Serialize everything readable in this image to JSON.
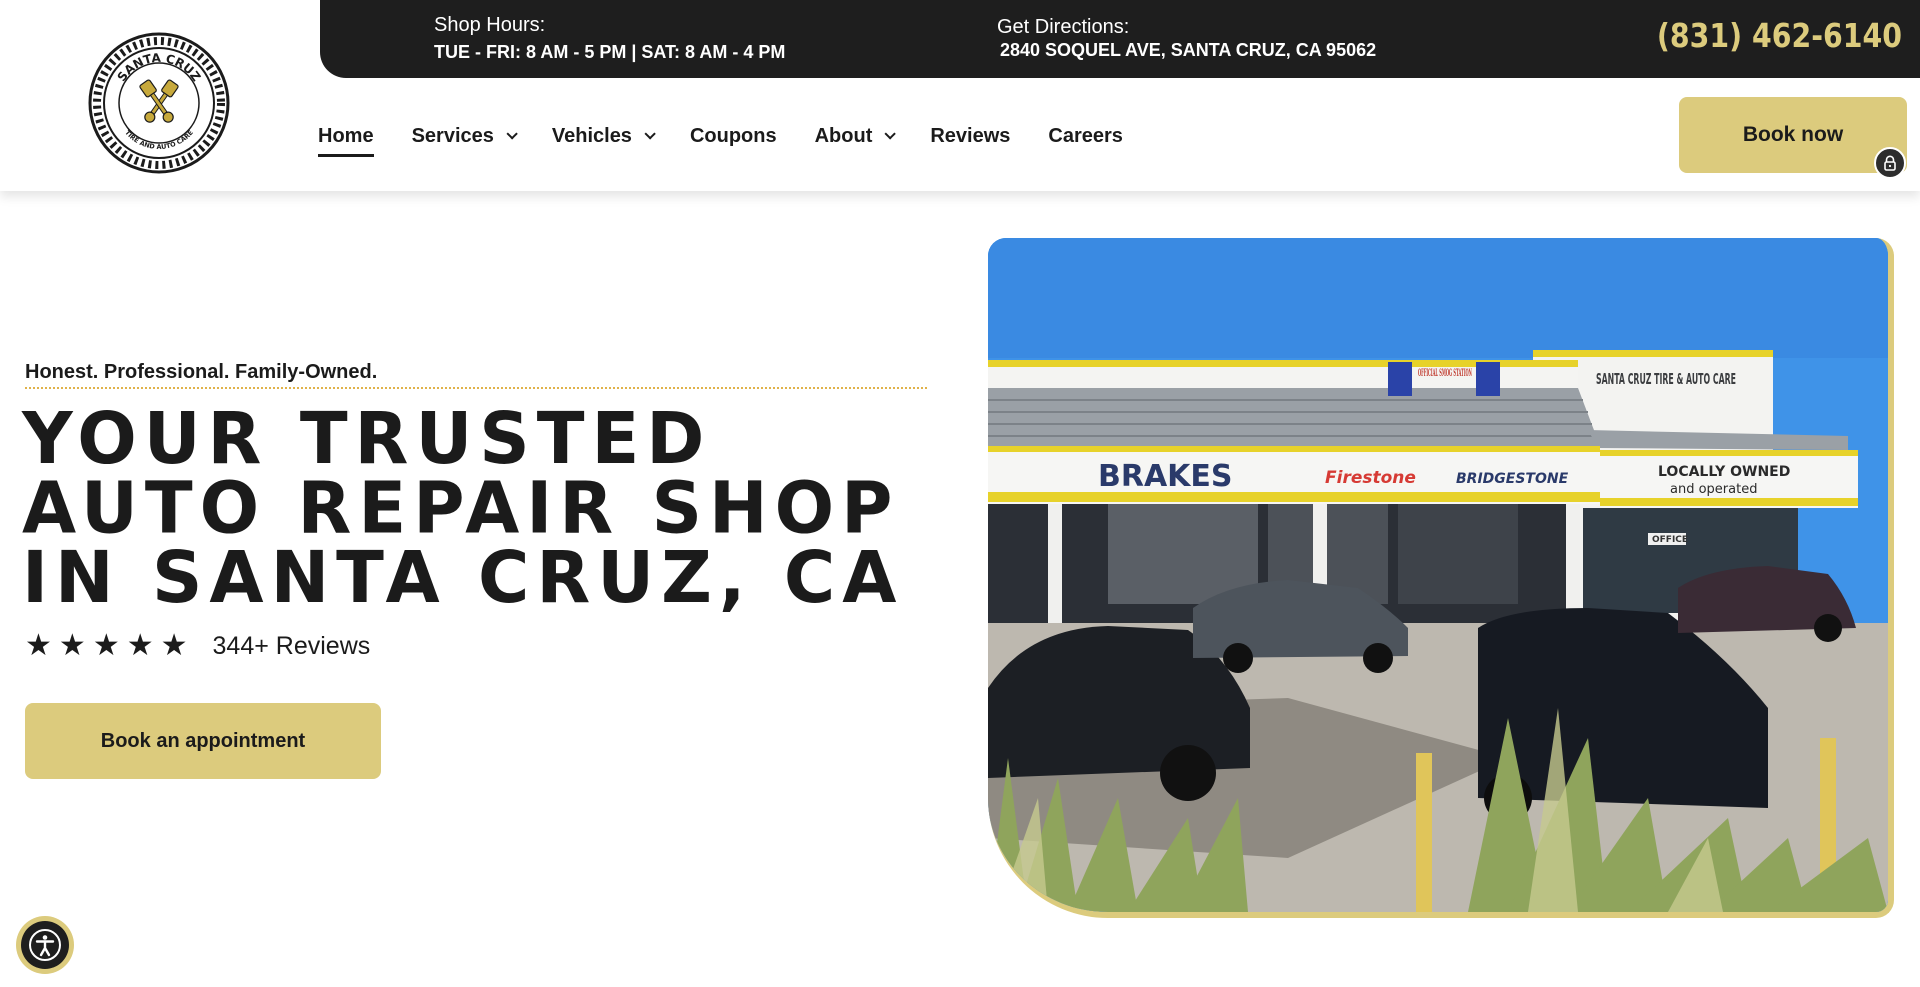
{
  "header": {
    "logo": {
      "name": "santa-cruz-tire-and-auto-care-logo",
      "text_top": "SANTA CRUZ",
      "text_bottom": "TIRE AND AUTO CARE"
    },
    "topbar": {
      "hours_label": "Shop Hours:",
      "hours_value": "TUE - FRI: 8 AM - 5 PM | SAT: 8 AM - 4 PM",
      "directions_label": "Get Directions:",
      "directions_value": "2840 SOQUEL AVE, SANTA CRUZ, CA 95062",
      "phone": "(831) 462-6140"
    },
    "nav": [
      {
        "label": "Home",
        "active": true,
        "has_dropdown": false
      },
      {
        "label": "Services",
        "active": false,
        "has_dropdown": true
      },
      {
        "label": "Vehicles",
        "active": false,
        "has_dropdown": true
      },
      {
        "label": "Coupons",
        "active": false,
        "has_dropdown": false
      },
      {
        "label": "About",
        "active": false,
        "has_dropdown": true
      },
      {
        "label": "Reviews",
        "active": false,
        "has_dropdown": false
      },
      {
        "label": "Careers",
        "active": false,
        "has_dropdown": false
      }
    ],
    "book_now_label": "Book now",
    "lock_icon": "lock-icon"
  },
  "hero": {
    "tagline": "Honest. Professional. Family-Owned.",
    "headline": "YOUR TRUSTED AUTO REPAIR SHOP IN SANTA CRUZ, CA",
    "rating": {
      "stars": 5,
      "star_glyph": "★",
      "reviews_text": "344+ Reviews"
    },
    "cta_label": "Book an appointment",
    "image": {
      "sign_brakes": "BRAKES",
      "sign_firestone": "Firestone",
      "sign_bridgestone": "BRIDGESTONE",
      "sign_smog": "OFFICIAL SMOG STATION",
      "sign_shop_name": "SANTA CRUZ TIRE & AUTO CARE",
      "sign_locally": "LOCALLY OWNED",
      "sign_operated": "and operated",
      "sign_office": "OFFICE"
    }
  },
  "accessibility_icon": "accessibility-icon",
  "colors": {
    "accent": "#dccb7d",
    "dark": "#1e1e1e",
    "text": "#1b1b1b",
    "dotted_line": "#e0b24a"
  }
}
